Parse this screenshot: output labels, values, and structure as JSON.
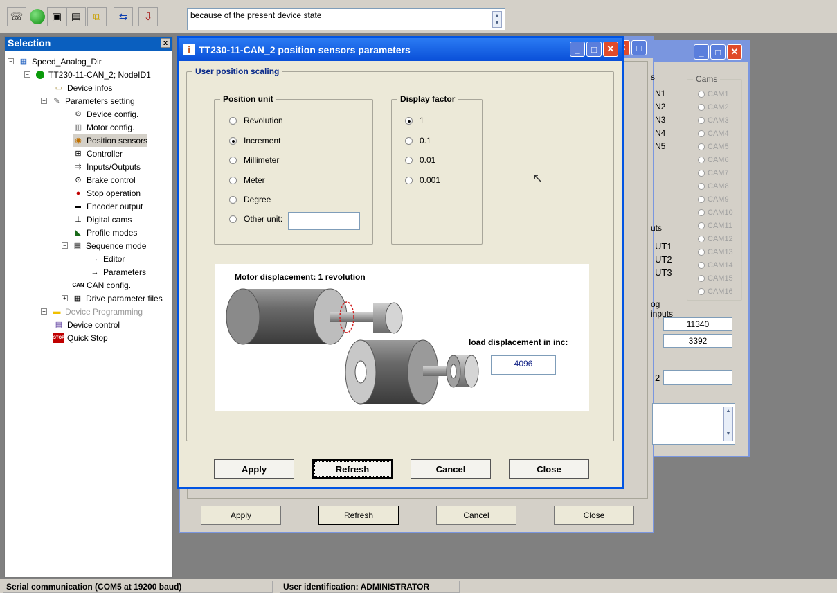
{
  "toolbar": {
    "message": "because of the present device state",
    "icons": [
      "modem-icon",
      "connect-icon",
      "device-icon",
      "window-icon",
      "config-icon",
      "transfer-icon",
      "download-icon"
    ]
  },
  "selection": {
    "title": "Selection",
    "close": "x",
    "items": [
      {
        "label": "Speed_Analog_Dir",
        "icon": "project-icon"
      },
      {
        "label": "TT230-11-CAN_2; NodeID1",
        "icon": "node-icon"
      },
      {
        "label": "Device infos",
        "icon": "info-icon"
      },
      {
        "label": "Parameters setting",
        "icon": "wrench-icon"
      },
      {
        "label": "Device config.",
        "icon": "device-config-icon"
      },
      {
        "label": "Motor config.",
        "icon": "motor-icon"
      },
      {
        "label": "Position sensors",
        "icon": "sensor-icon"
      },
      {
        "label": "Controller",
        "icon": "controller-icon"
      },
      {
        "label": "Inputs/Outputs",
        "icon": "io-icon"
      },
      {
        "label": "Brake control",
        "icon": "brake-icon"
      },
      {
        "label": "Stop operation",
        "icon": "stop-pin-icon"
      },
      {
        "label": "Encoder output",
        "icon": "encoder-icon"
      },
      {
        "label": "Digital cams",
        "icon": "cam-icon"
      },
      {
        "label": "Profile modes",
        "icon": "profile-icon"
      },
      {
        "label": "Sequence mode",
        "icon": "sequence-icon"
      },
      {
        "label": "Editor",
        "icon": "arrow-icon"
      },
      {
        "label": "Parameters",
        "icon": "arrow-icon"
      },
      {
        "label": "CAN config.",
        "icon": "can-icon"
      },
      {
        "label": "Drive parameter files",
        "icon": "file-icon"
      },
      {
        "label": "Device Programming",
        "icon": "folder-icon"
      },
      {
        "label": "Device control",
        "icon": "control-icon"
      },
      {
        "label": "Quick Stop",
        "icon": "stop-icon"
      }
    ]
  },
  "status": {
    "serial": "Serial communication (COM5 at 19200 baud)",
    "user": "User identification: ADMINISTRATOR"
  },
  "back_window": {
    "apply": "Apply",
    "refresh": "Refresh",
    "cancel": "Cancel",
    "close": "Close",
    "partial": [
      "s",
      "N1",
      "N2",
      "N3",
      "N4",
      "N5",
      "uts",
      "UT1",
      "UT2",
      "UT3",
      "og inputs",
      "11340",
      "3392",
      "2"
    ]
  },
  "cams": {
    "title": "Cams",
    "items": [
      "CAM1",
      "CAM2",
      "CAM3",
      "CAM4",
      "CAM5",
      "CAM6",
      "CAM7",
      "CAM8",
      "CAM9",
      "CAM10",
      "CAM11",
      "CAM12",
      "CAM13",
      "CAM14",
      "CAM15",
      "CAM16"
    ]
  },
  "dialog": {
    "title": "TT230-11-CAN_2 position sensors parameters",
    "group": "User position scaling",
    "position_unit": {
      "title": "Position unit",
      "options": [
        "Revolution",
        "Increment",
        "Millimeter",
        "Meter",
        "Degree",
        "Other unit:"
      ],
      "selected": "Increment",
      "other_value": ""
    },
    "display_factor": {
      "title": "Display factor",
      "options": [
        "1",
        "0.1",
        "0.01",
        "0.001"
      ],
      "selected": "1"
    },
    "diagram": {
      "motor_label": "Motor displacement: 1 revolution",
      "load_label": "load displacement in inc:",
      "load_value": "4096"
    },
    "buttons": {
      "apply": "Apply",
      "refresh": "Refresh",
      "cancel": "Cancel",
      "close": "Close"
    }
  }
}
